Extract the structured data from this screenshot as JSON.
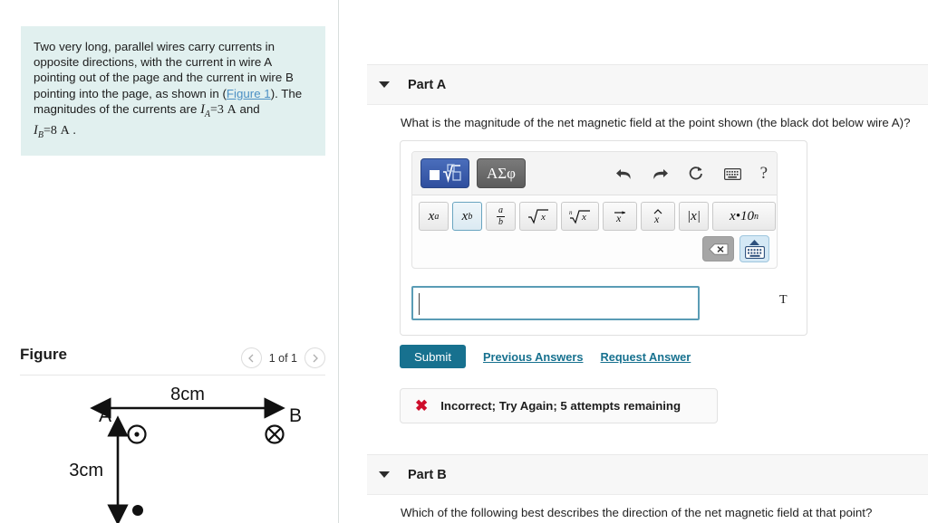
{
  "left_panel": {
    "problem": {
      "line1": "Two very long, parallel wires carry currents in",
      "line2": "opposite directions, with the current in wire A",
      "line3": "pointing out of the page and the current in wire B",
      "line4_a": "pointing into the page, as shown in (",
      "figure_link": "Figure 1",
      "line4_b": ").  The",
      "line5": "magnitudes of the currents are",
      "current_a_sym": "I",
      "current_a_subscript": "A",
      "current_a_value": "=3",
      "current_a_unit": "A",
      "conjunction": "and",
      "current_b_sym": "I",
      "current_b_subscript": "B",
      "current_b_value": "=8",
      "current_b_unit": "A",
      "period": "."
    },
    "figure": {
      "title": "Figure",
      "prev_icon": "chevron-left-icon",
      "counter": "1 of 1",
      "next_icon": "chevron-right-icon",
      "labels": {
        "wire_a": "A",
        "wire_b": "B",
        "horizontal_distance": "8cm",
        "vertical_distance": "3cm"
      },
      "wire_a_symbol": "current-out-of-page-dot",
      "wire_b_symbol": "current-into-page-cross",
      "field_point": "black-dot"
    }
  },
  "right_panel": {
    "part_a": {
      "caret_icon": "caret-down-icon",
      "label": "Part A",
      "question": "What is the magnitude of the net magnetic field at the point shown (the black dot below wire A)?",
      "mathpad": {
        "mode_math_icon": "math-template-icon",
        "mode_greek_label": "ΑΣφ",
        "undo_icon": "undo-arrow-icon",
        "redo_icon": "redo-arrow-icon",
        "reset_icon": "refresh-icon",
        "keyboard_icon": "keyboard-icon",
        "help_label": "?",
        "buttons": [
          {
            "name": "superscript",
            "label": "x^a",
            "active": false
          },
          {
            "name": "subscript",
            "label": "x_b",
            "active": true
          },
          {
            "name": "fraction",
            "label": "a/b",
            "active": false
          },
          {
            "name": "square-root",
            "label": "√x",
            "active": false
          },
          {
            "name": "nth-root",
            "label": "ⁿ√x",
            "active": false
          },
          {
            "name": "vector",
            "label": "x-vector",
            "active": false
          },
          {
            "name": "unit-vector",
            "label": "x-hat",
            "active": false
          },
          {
            "name": "absolute-value",
            "label": "|x|",
            "active": false
          },
          {
            "name": "scientific-notation",
            "label": "x·10ⁿ",
            "active": false
          }
        ],
        "backspace_icon": "backspace-icon",
        "keypad_toggle_icon": "keyboard-up-icon"
      },
      "answer_value": "",
      "answer_unit": "T",
      "submit_label": "Submit",
      "previous_answers_label": "Previous Answers",
      "request_answer_label": "Request Answer",
      "feedback": {
        "icon": "x-cross-icon",
        "message": "Incorrect; Try Again; 5 attempts remaining"
      }
    },
    "part_b": {
      "caret_icon": "caret-down-icon",
      "label": "Part B",
      "question": "Which of the following best describes the direction of the net magnetic field at that point?"
    }
  },
  "colors": {
    "problem_bg": "#e1f0ef",
    "link_blue": "#4c90c4",
    "submit_teal": "#17718f",
    "error_red": "#ce0d2b",
    "input_border": "#5a9cb5"
  }
}
